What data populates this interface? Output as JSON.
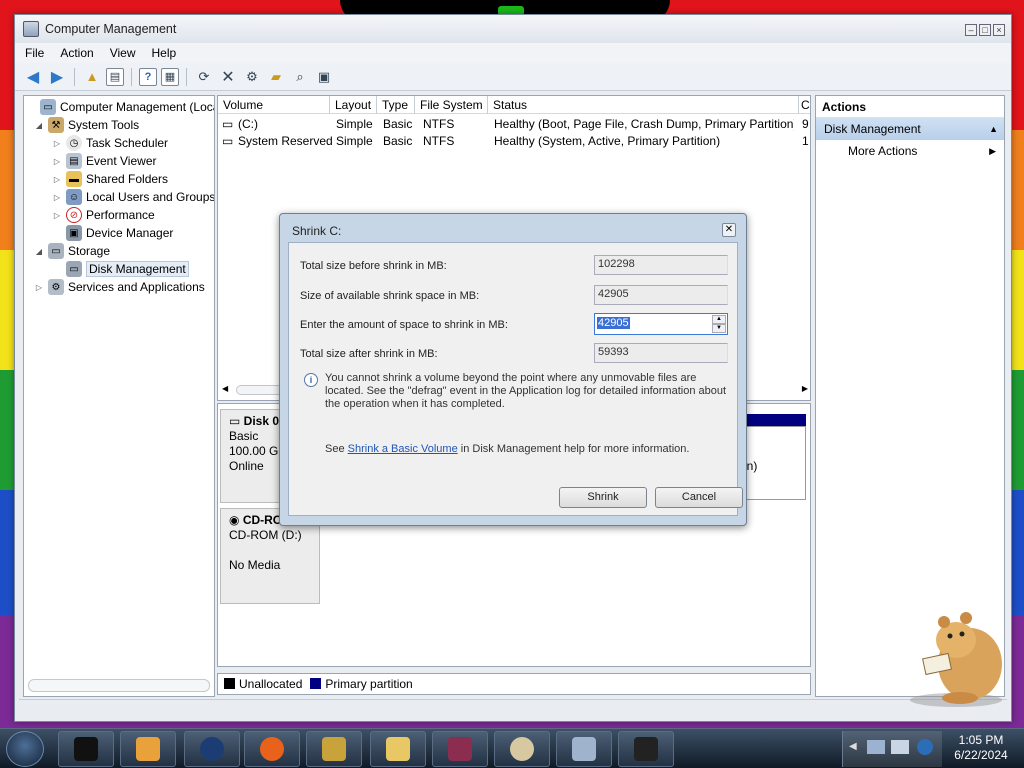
{
  "window": {
    "title": "Computer Management",
    "menu": [
      "File",
      "Action",
      "View",
      "Help"
    ]
  },
  "tree": {
    "items": [
      {
        "label": "Computer Management (Local",
        "icon": "computer-icon"
      },
      {
        "label": "System Tools",
        "icon": "tools-icon"
      },
      {
        "label": "Task Scheduler",
        "icon": "clock-icon"
      },
      {
        "label": "Event Viewer",
        "icon": "event-icon"
      },
      {
        "label": "Shared Folders",
        "icon": "folder-icon"
      },
      {
        "label": "Local Users and Groups",
        "icon": "users-icon"
      },
      {
        "label": "Performance",
        "icon": "performance-icon"
      },
      {
        "label": "Device Manager",
        "icon": "device-icon"
      },
      {
        "label": "Storage",
        "icon": "storage-icon"
      },
      {
        "label": "Disk Management",
        "icon": "disk-icon"
      },
      {
        "label": "Services and Applications",
        "icon": "services-icon"
      }
    ]
  },
  "volumes": {
    "columns": [
      "Volume",
      "Layout",
      "Type",
      "File System",
      "Status",
      "C"
    ],
    "rows": [
      {
        "volume": "(C:)",
        "layout": "Simple",
        "type": "Basic",
        "fs": "NTFS",
        "status": "Healthy (Boot, Page File, Crash Dump, Primary Partition)",
        "c": "9"
      },
      {
        "volume": "System Reserved",
        "layout": "Simple",
        "type": "Basic",
        "fs": "NTFS",
        "status": "Healthy (System, Active, Primary Partition)",
        "c": "1"
      }
    ]
  },
  "disks": {
    "disk0": {
      "name": "Disk 0",
      "type": "Basic",
      "size": "100.00 GB",
      "state": "Online",
      "partition_tail": "on)"
    },
    "cdrom": {
      "name": "CD-RO",
      "drive": "CD-ROM (D:)",
      "state": "No Media"
    }
  },
  "legend": {
    "unallocated": "Unallocated",
    "primary": "Primary partition",
    "unallocated_color": "#000000",
    "primary_color": "#000080"
  },
  "actions": {
    "header": "Actions",
    "section": "Disk Management",
    "item": "More Actions"
  },
  "dialog": {
    "title": "Shrink C:",
    "total_label": "Total size before shrink in MB:",
    "total_value": "102298",
    "available_label": "Size of available shrink space in MB:",
    "available_value": "42905",
    "amount_label": "Enter the amount of space to shrink in MB:",
    "amount_value": "42905",
    "after_label": "Total size after shrink in MB:",
    "after_value": "59393",
    "note": "You cannot shrink a volume beyond the point where any unmovable files are located. See the \"defrag\" event in the Application log for detailed information about the operation when it has completed.",
    "see_prefix": "See",
    "see_link": "Shrink a Basic Volume",
    "see_suffix": "in Disk Management help for more information.",
    "shrink_button": "Shrink",
    "cancel_button": "Cancel"
  },
  "taskbar": {
    "time": "1:05 PM",
    "date": "6/22/2024"
  },
  "colors": {
    "selection": "#3b6fd6",
    "link": "#1f55b8",
    "actions_header": "#b8d0ea"
  }
}
